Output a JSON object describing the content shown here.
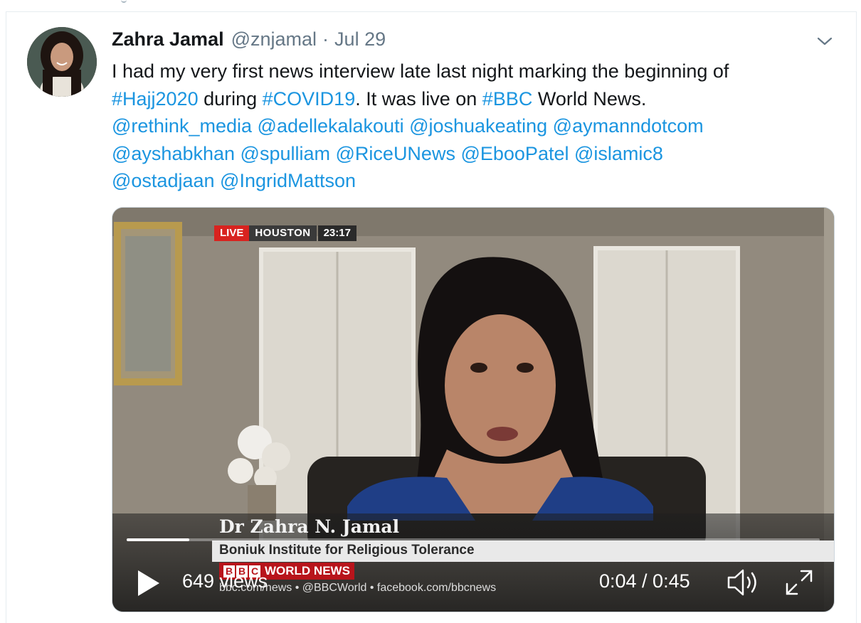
{
  "tweet": {
    "display_name": "Zahra Jamal",
    "handle": "@znjamal",
    "separator": "·",
    "date": "Jul 29",
    "text": {
      "line1": "I had my very first news interview late last night marking the beginning of",
      "hashtag_hajj": "#Hajj2020",
      "during": " during ",
      "hashtag_covid": "#COVID19",
      "live_on": ". It was live on ",
      "hashtag_bbc": "#BBC",
      "world_news": " World News.",
      "mentions": [
        "@rethink_media",
        "@adellekalakouti",
        "@joshuakeating",
        "@aymanndotcom",
        "@ayshabkhan",
        "@spulliam",
        "@RiceUNews",
        "@EbooPatel",
        "@islamic8",
        "@ostadjaan",
        "@IngridMattson"
      ]
    }
  },
  "video": {
    "live_label": "LIVE",
    "city": "HOUSTON",
    "clock": "23:17",
    "lower_third_name": "Dr Zahra N. Jamal",
    "lower_third_title": "Boniuk Institute  for Religious Tolerance",
    "channel_letters": [
      "B",
      "B",
      "C"
    ],
    "channel_name": "WORLD NEWS",
    "ticker": "bbc.com/news   • @BBCWorld   • facebook.com/bbcnews",
    "views": "649 views",
    "time": "0:04 / 0:45",
    "progress": 0.09
  },
  "colors": {
    "link": "#1b95e0",
    "muted": "#657786",
    "bbc_red": "#b8141b",
    "live_red": "#d8231f"
  },
  "icons": [
    "chevron-down-icon",
    "play-icon",
    "volume-icon",
    "fullscreen-icon"
  ]
}
